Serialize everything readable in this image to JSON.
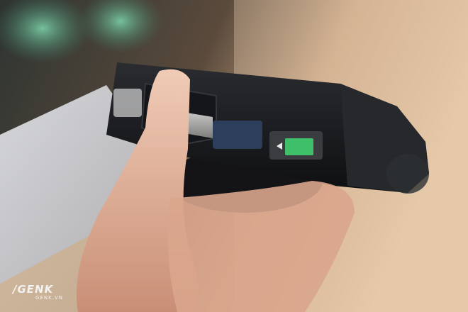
{
  "photo": {
    "subject": "camera-bottom-battery-door-open",
    "colors": {
      "background_warm": "#d9b48f",
      "background_dark": "#3a3430",
      "bokeh_green": "#5fae8c",
      "camera_body": "#1c1d20",
      "skin": "#e6bca6",
      "paper": "#c9c9cc",
      "battery_label": "#3fbf6a"
    }
  },
  "watermark": {
    "brand": "/GENK",
    "site": "GENK.VN"
  }
}
